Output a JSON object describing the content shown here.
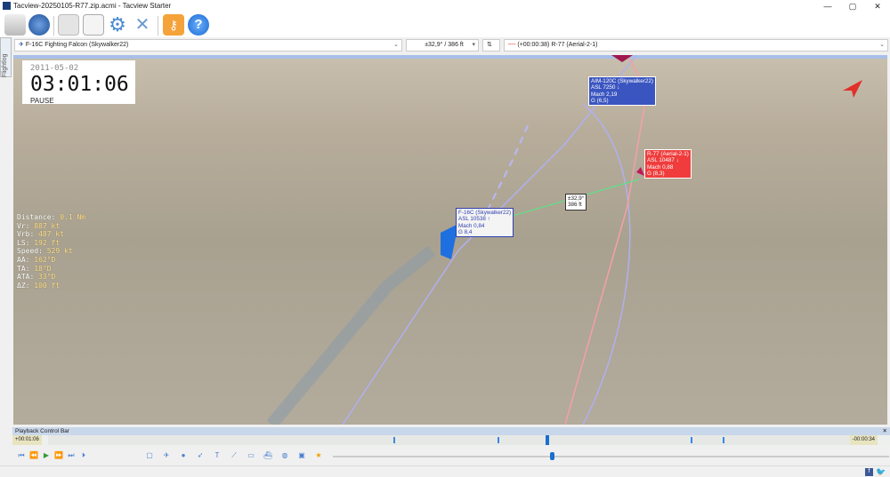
{
  "window": {
    "title": "Tacview-20250105-R77.zip.acmi - Tacview Starter",
    "minimize": "—",
    "maximize": "▢",
    "close": "✕"
  },
  "toolbar": {
    "items": [
      "usb-drive-icon",
      "globe-icon",
      "document-icon",
      "notepad-pen-icon",
      "gear-icon",
      "tools-icon",
      "key-icon",
      "help-icon"
    ]
  },
  "sidebar": {
    "tab_label": "Flightlog"
  },
  "selectors": {
    "primary_object": "F-16C Fighting Falcon (Skywalker22)",
    "angle_range": "±32,9° / 386 ft",
    "secondary_object": "(+00:00:38) R-77 (Aerial-2-1)"
  },
  "clock": {
    "date": "2011-05-02",
    "time": "03:01:06",
    "state": "PAUSE"
  },
  "telemetry": [
    {
      "label": "Distance:",
      "value": "0.1 Nm"
    },
    {
      "label": "Vr:",
      "value": "887 kt"
    },
    {
      "label": "Vrb:",
      "value": "487 kt"
    },
    {
      "label": "LS:",
      "value": "192 ft"
    },
    {
      "label": "Speed:",
      "value": "529 kt"
    },
    {
      "label": "AA:",
      "value": "162°D"
    },
    {
      "label": "TA:",
      "value": "18°D"
    },
    {
      "label": "ATA:",
      "value": "33°D"
    },
    {
      "label": "ΔZ:",
      "value": "100 ft"
    }
  ],
  "labels": {
    "aim120": [
      "AIM-120C (Skywalker22)",
      "ASL 7250 ↓",
      "Mach 2,19",
      "G (6,5)"
    ],
    "r77": [
      "R-77 (Aerial-2-1)",
      "ASL 10487 ↓",
      "Mach 0,88",
      "G (8,3)"
    ],
    "f16": [
      "F-16C (Skywalker22)",
      "ASL 10538 ↑",
      "Mach 0,84",
      "G 8,4"
    ],
    "range": [
      "±32,9°",
      "386 ft"
    ]
  },
  "colors": {
    "blue_label": "#3b55c0",
    "red_label": "#f03c3c",
    "friendly": "#1e6fe0",
    "hostile": "#c0185a"
  },
  "playback": {
    "title": "Playback Control Bar",
    "elapsed": "+00:01:06",
    "remaining": "-00:00:34",
    "position_percent": 62,
    "marker_percents": [
      43,
      56,
      62,
      80,
      84
    ]
  },
  "controls": [
    "skip-start",
    "step-back",
    "play",
    "step-forward",
    "skip-end",
    "frame",
    "camera",
    "aircraft",
    "globe",
    "missile",
    "text",
    "ruler",
    "display",
    "ship",
    "sphere",
    "filter",
    "bookmark"
  ],
  "status": {
    "icons": [
      "facebook-icon",
      "twitter-icon"
    ]
  }
}
